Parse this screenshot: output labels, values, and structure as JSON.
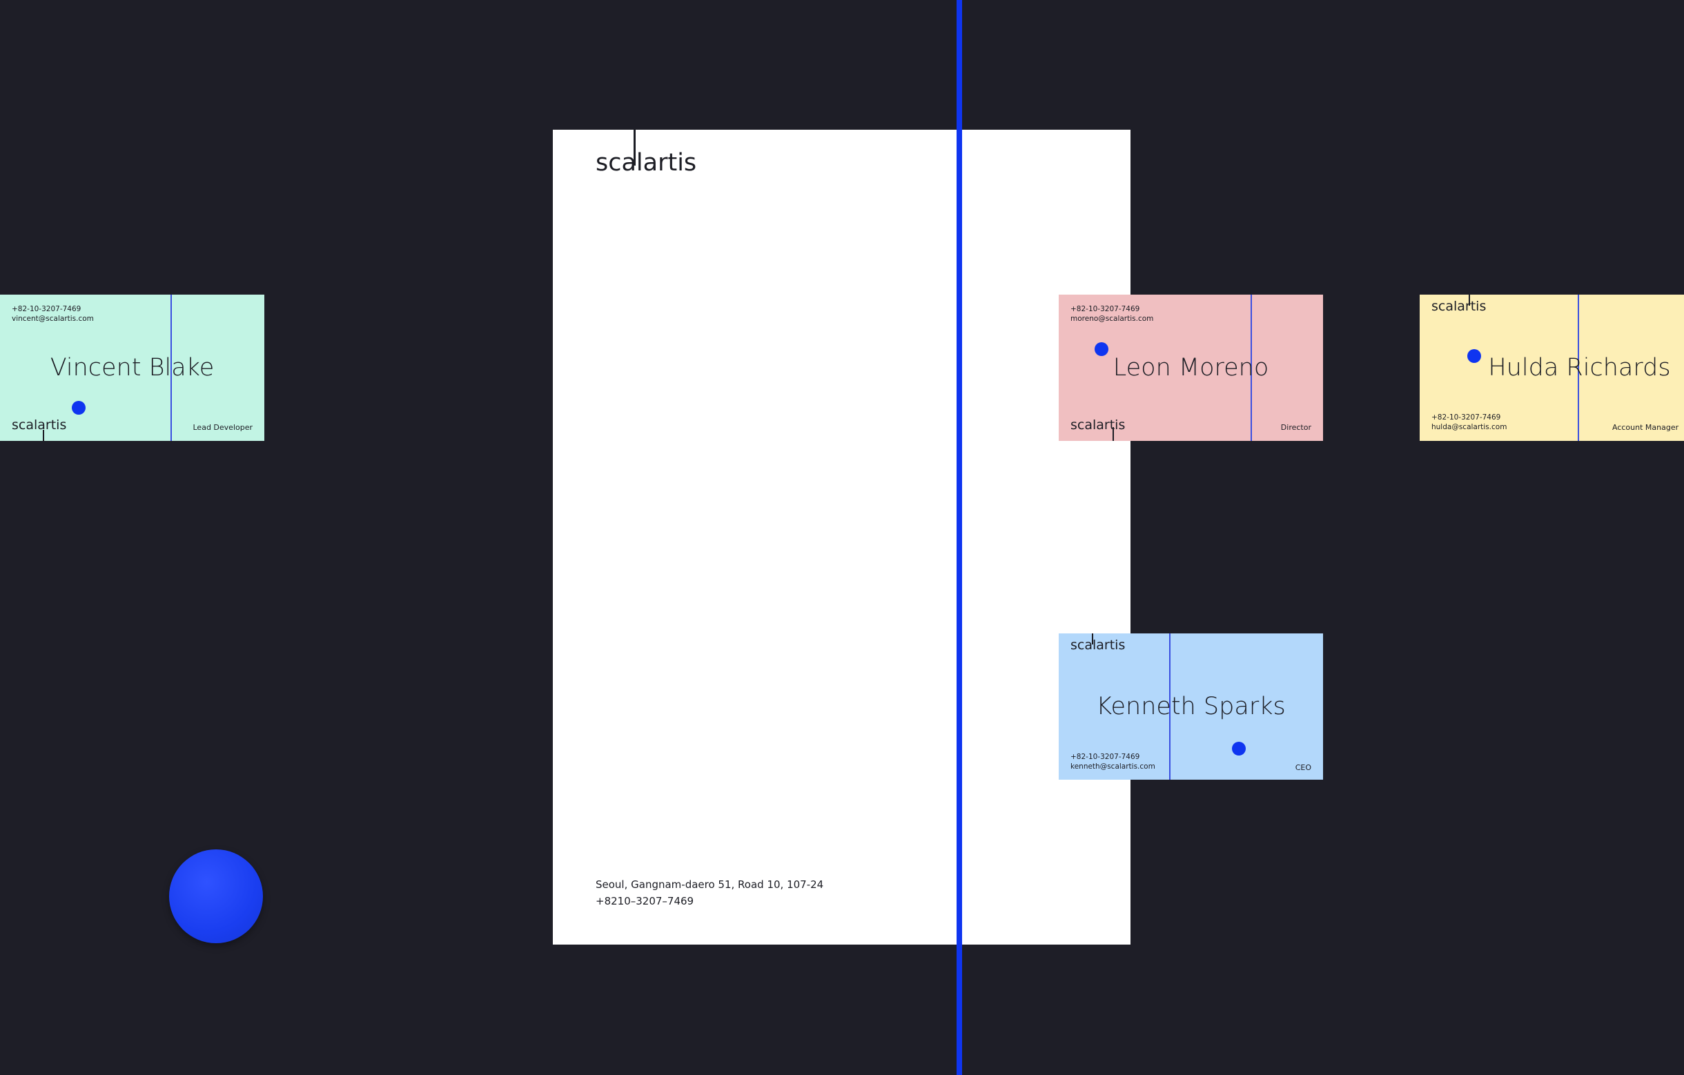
{
  "brand": {
    "logo": "scalartis",
    "accent_color": "#0f35f0",
    "background_color": "#1e1e27"
  },
  "letterhead": {
    "logo": "scalartis",
    "address_line1": "Seoul, Gangnam-daero 51, Road 10, 107-24",
    "address_line2": "+8210–3207–7469"
  },
  "cards": {
    "vincent": {
      "name": "Vincent Blake",
      "phone": "+82-10-3207-7469",
      "email": "vincent@scalartis.com",
      "role": "Lead Developer",
      "logo": "scalartis",
      "color": "#c2f4e4"
    },
    "leon": {
      "name": "Leon Moreno",
      "phone": "+82-10-3207-7469",
      "email": "moreno@scalartis.com",
      "role": "Director",
      "logo": "scalartis",
      "color": "#f0bfc1"
    },
    "hulda": {
      "name": "Hulda Richards",
      "phone": "+82-10-3207-7469",
      "email": "hulda@scalartis.com",
      "role": "Account Manager",
      "logo": "scalartis",
      "color": "#fdefb6"
    },
    "kenneth": {
      "name": "Kenneth Sparks",
      "phone": "+82-10-3207-7469",
      "email": "kenneth@scalartis.com",
      "role": "CEO",
      "logo": "scalartis",
      "color": "#b3d8fb"
    }
  }
}
